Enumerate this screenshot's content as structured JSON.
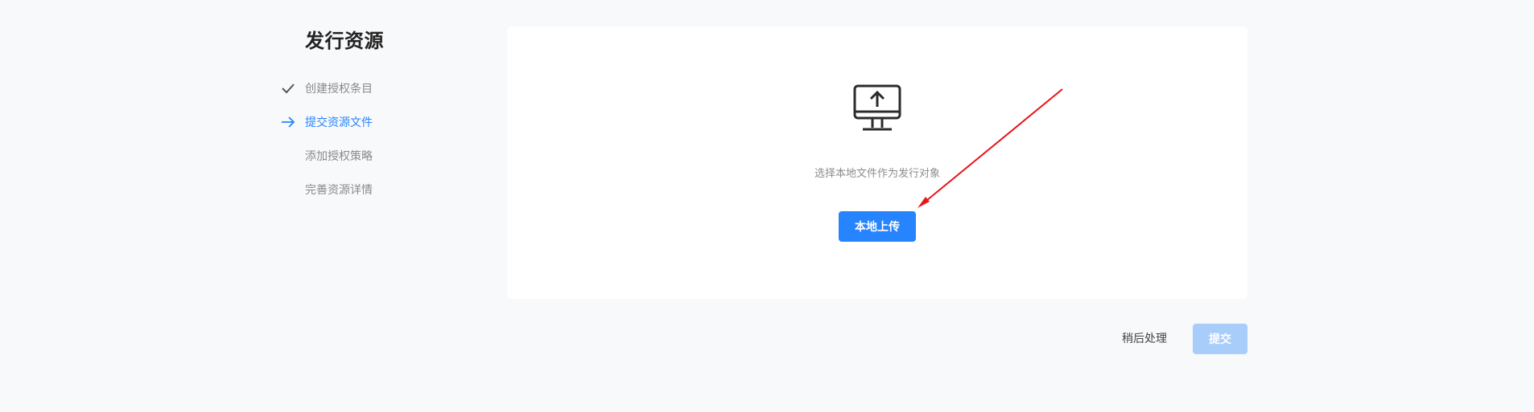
{
  "page_title": "发行资源",
  "steps": [
    {
      "label": "创建授权条目",
      "state": "done",
      "icon": "check-icon"
    },
    {
      "label": "提交资源文件",
      "state": "current",
      "icon": "arrow-right-icon"
    },
    {
      "label": "添加授权策略",
      "state": "pending",
      "icon": ""
    },
    {
      "label": "完善资源详情",
      "state": "pending",
      "icon": ""
    }
  ],
  "upload": {
    "icon": "monitor-upload-icon",
    "hint": "选择本地文件作为发行对象",
    "button_label": "本地上传"
  },
  "footer": {
    "later_label": "稍后处理",
    "submit_label": "提交"
  },
  "colors": {
    "accent": "#2784ff",
    "accent_disabled": "#a9cdfb",
    "annotation": "#e8141b"
  }
}
